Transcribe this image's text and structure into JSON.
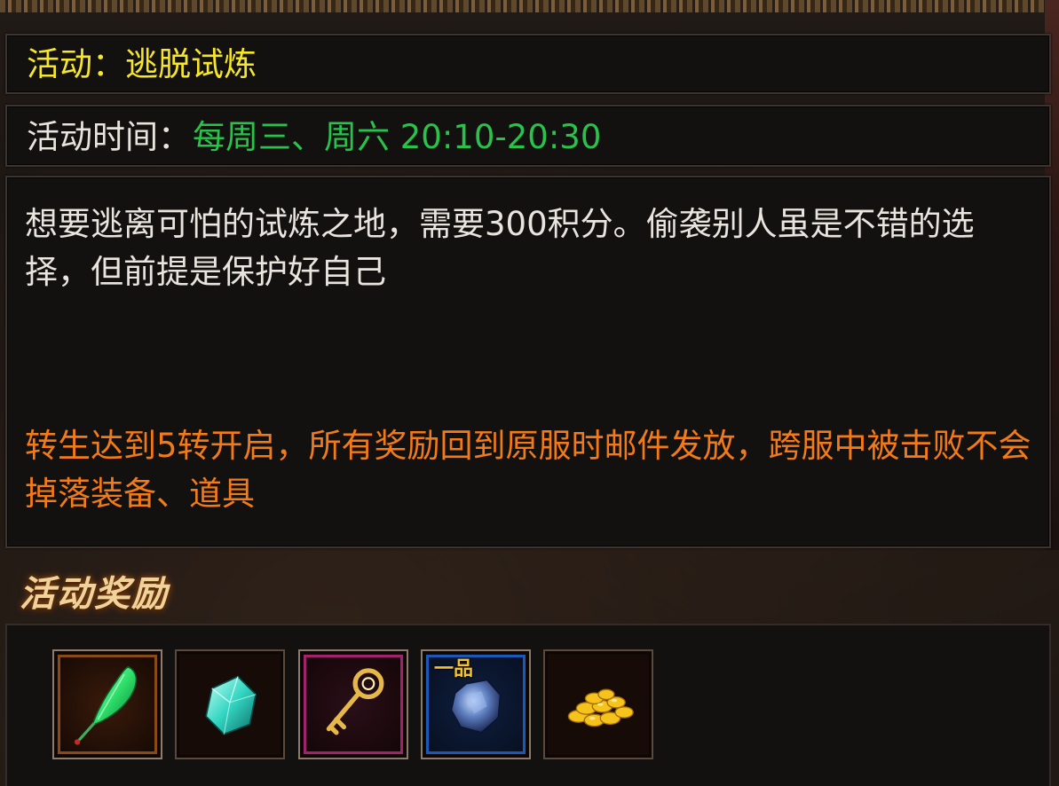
{
  "activity": {
    "title": "活动：逃脱试炼",
    "time_label": "活动时间：",
    "time_value": "每周三、周六 20:10-20:30",
    "description": "想要逃离可怕的试炼之地，需要300积分。偷袭别人虽是不错的选择，但前提是保护好自己",
    "notice": "转生达到5转开启，所有奖励回到原服时邮件发放，跨服中被击败不会掉落装备、道具"
  },
  "rewards": {
    "heading": "活动奖励",
    "items": [
      {
        "icon": "green-feather-icon",
        "frame_color": "#8a4a15"
      },
      {
        "icon": "cyan-gem-icon",
        "frame_color": "#5b4a3a"
      },
      {
        "icon": "golden-key-icon",
        "frame_color": "#a0236b"
      },
      {
        "icon": "blue-ore-icon",
        "frame_color": "#1c58b8",
        "grade": "一品"
      },
      {
        "icon": "gold-coins-icon",
        "frame_color": "#5b4a3a"
      }
    ]
  },
  "colors": {
    "title": "#f6e62b",
    "time_value": "#29c24a",
    "description": "#e9e5de",
    "notice": "#f27a17",
    "heading": "#f0d39a"
  }
}
